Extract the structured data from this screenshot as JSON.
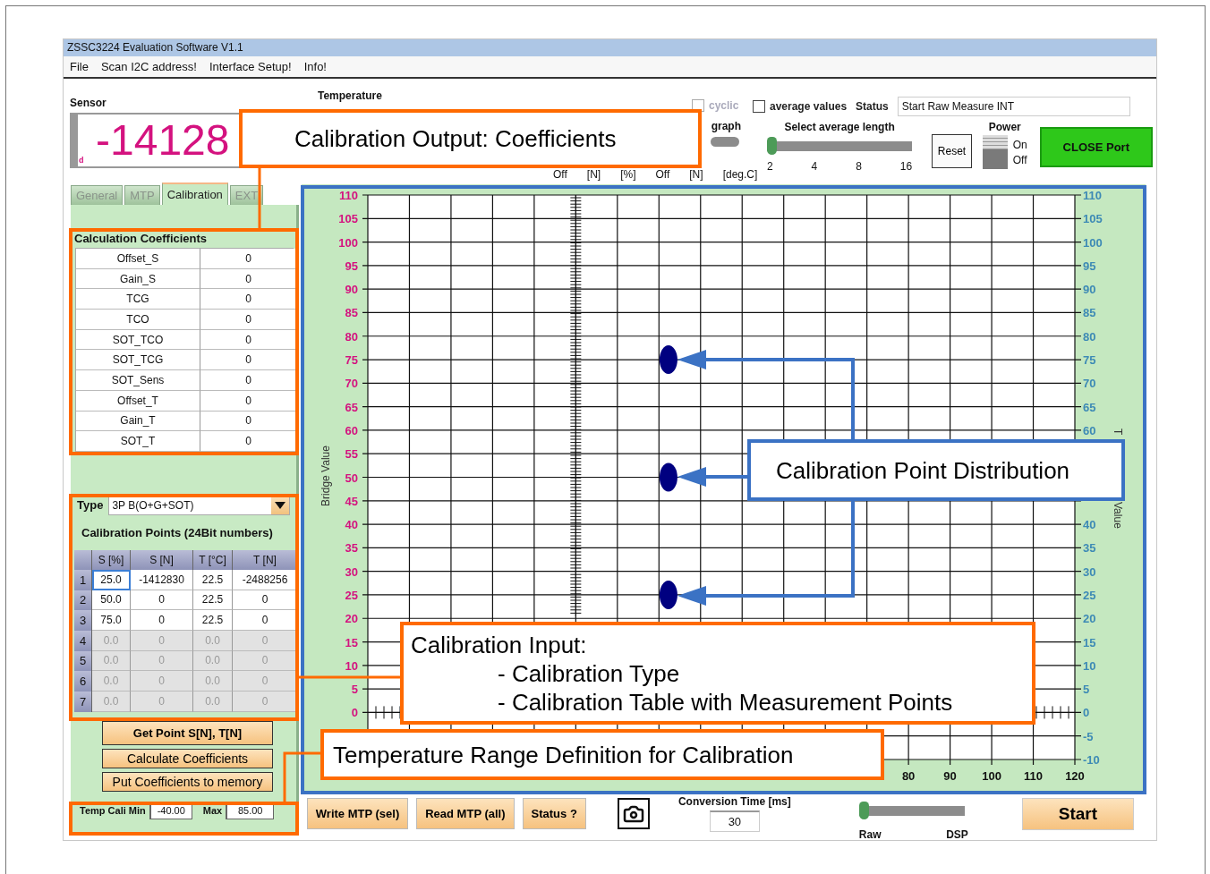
{
  "window": {
    "title": "ZSSC3224 Evaluation Software V1.1"
  },
  "menu": [
    "File",
    "Scan I2C address!",
    "Interface Setup!",
    "Info!"
  ],
  "sensor": {
    "label": "Sensor",
    "value": "-14128",
    "unit": "d"
  },
  "temperature": {
    "label": "Temperature"
  },
  "measure": {
    "cyclic": {
      "label": "cyclic",
      "checked": false,
      "disabled": true
    },
    "graph_label": "graph",
    "units": [
      "Off",
      "[N]",
      "[%]",
      "Off",
      "[N]",
      "[deg.C]"
    ]
  },
  "average": {
    "label": "average values",
    "checked": false
  },
  "status": {
    "label": "Status",
    "value": "Start Raw Measure INT"
  },
  "average_length": {
    "label": "Select average length",
    "level": 0,
    "ticks": [
      "2",
      "4",
      "8",
      "16"
    ]
  },
  "reset_button": "Reset",
  "power": {
    "label": "Power",
    "on_label": "On",
    "off_label": "Off",
    "on": true
  },
  "close_port_button": "CLOSE Port",
  "tabs": [
    {
      "label": "General",
      "selected": false
    },
    {
      "label": "MTP",
      "selected": false
    },
    {
      "label": "Calibration",
      "selected": true
    },
    {
      "label": "EXT",
      "selected": false
    }
  ],
  "coefficients": {
    "title": "Calculation Coefficients",
    "rows": [
      {
        "name": "Offset_S",
        "value": "0"
      },
      {
        "name": "Gain_S",
        "value": "0"
      },
      {
        "name": "TCG",
        "value": "0"
      },
      {
        "name": "TCO",
        "value": "0"
      },
      {
        "name": "SOT_TCO",
        "value": "0"
      },
      {
        "name": "SOT_TCG",
        "value": "0"
      },
      {
        "name": "SOT_Sens",
        "value": "0"
      },
      {
        "name": "Offset_T",
        "value": "0"
      },
      {
        "name": "Gain_T",
        "value": "0"
      },
      {
        "name": "SOT_T",
        "value": "0"
      }
    ]
  },
  "calibration": {
    "type_label": "Type",
    "type_value": "3P B(O+G+SOT)",
    "points_title": "Calibration Points (24Bit numbers)",
    "columns": [
      "S [%]",
      "S [N]",
      "T [°C]",
      "T [N]"
    ],
    "rows": [
      {
        "index": "1",
        "cells": [
          "25.0",
          "-1412830",
          "22.5",
          "-2488256"
        ],
        "disabled": false,
        "selected": true
      },
      {
        "index": "2",
        "cells": [
          "50.0",
          "0",
          "22.5",
          "0"
        ],
        "disabled": false,
        "selected": false
      },
      {
        "index": "3",
        "cells": [
          "75.0",
          "0",
          "22.5",
          "0"
        ],
        "disabled": false,
        "selected": false
      },
      {
        "index": "4",
        "cells": [
          "0.0",
          "0",
          "0.0",
          "0"
        ],
        "disabled": true,
        "selected": false
      },
      {
        "index": "5",
        "cells": [
          "0.0",
          "0",
          "0.0",
          "0"
        ],
        "disabled": true,
        "selected": false
      },
      {
        "index": "6",
        "cells": [
          "0.0",
          "0",
          "0.0",
          "0"
        ],
        "disabled": true,
        "selected": false
      },
      {
        "index": "7",
        "cells": [
          "0.0",
          "0",
          "0.0",
          "0"
        ],
        "disabled": true,
        "selected": false
      }
    ]
  },
  "actions": [
    {
      "label": "Get Point S[N], T[N]",
      "kind": "primary"
    },
    {
      "label": "Calculate Coefficients",
      "kind": "plain"
    },
    {
      "label": "Put Coefficients to memory",
      "kind": "plain"
    }
  ],
  "temp_range": {
    "min_label": "Temp Cali Min",
    "min": "-40.00",
    "max_label": "Max",
    "max": "85.00"
  },
  "chart": {
    "right_title_parts": [
      "T",
      "Value"
    ],
    "right_ticks": [
      "110",
      "105",
      "100",
      "95",
      "90",
      "85",
      "80",
      "75",
      "70",
      "65",
      "60",
      "40",
      "35",
      "30",
      "25",
      "20",
      "15",
      "10",
      "5",
      "0",
      "-5",
      "-10"
    ],
    "chart_data": {
      "type": "scatter",
      "grid": true,
      "ylabel": "Bridge Value",
      "xlim": [
        -50,
        120
      ],
      "ylim": [
        -10,
        110
      ],
      "xticks": [
        80,
        90,
        100,
        110,
        120
      ],
      "yticks": [
        0,
        5,
        10,
        15,
        20,
        25,
        30,
        35,
        40,
        45,
        50,
        55,
        60,
        65,
        70,
        75,
        80,
        85,
        90,
        95,
        100,
        105,
        110
      ],
      "x": [
        22.5
      ],
      "series": [
        {
          "color": "#000080",
          "values": [
            75
          ]
        },
        {
          "color": "#000080",
          "values": [
            50
          ]
        },
        {
          "color": "#000080",
          "values": [
            25
          ]
        }
      ]
    }
  },
  "bottom": {
    "buttons": [
      "Write MTP (sel)",
      "Read MTP (all)",
      "Status ?"
    ],
    "conversion": {
      "label": "Conversion Time [ms]",
      "value": "30"
    },
    "mode": {
      "level": 0,
      "labels": [
        "Raw",
        "DSP"
      ]
    },
    "start_button": "Start"
  },
  "callouts": [
    {
      "kind": "orange",
      "lines": [
        "Calibration Output: Coefficients"
      ]
    },
    {
      "kind": "blue",
      "lines": [
        "Calibration Point Distribution"
      ]
    },
    {
      "kind": "orange",
      "lines": [
        "Calibration Input:",
        "- Calibration Type",
        "- Calibration Table with Measurement Points"
      ]
    },
    {
      "kind": "orange",
      "lines": [
        "Temperature Range Definition for Calibration"
      ]
    }
  ]
}
